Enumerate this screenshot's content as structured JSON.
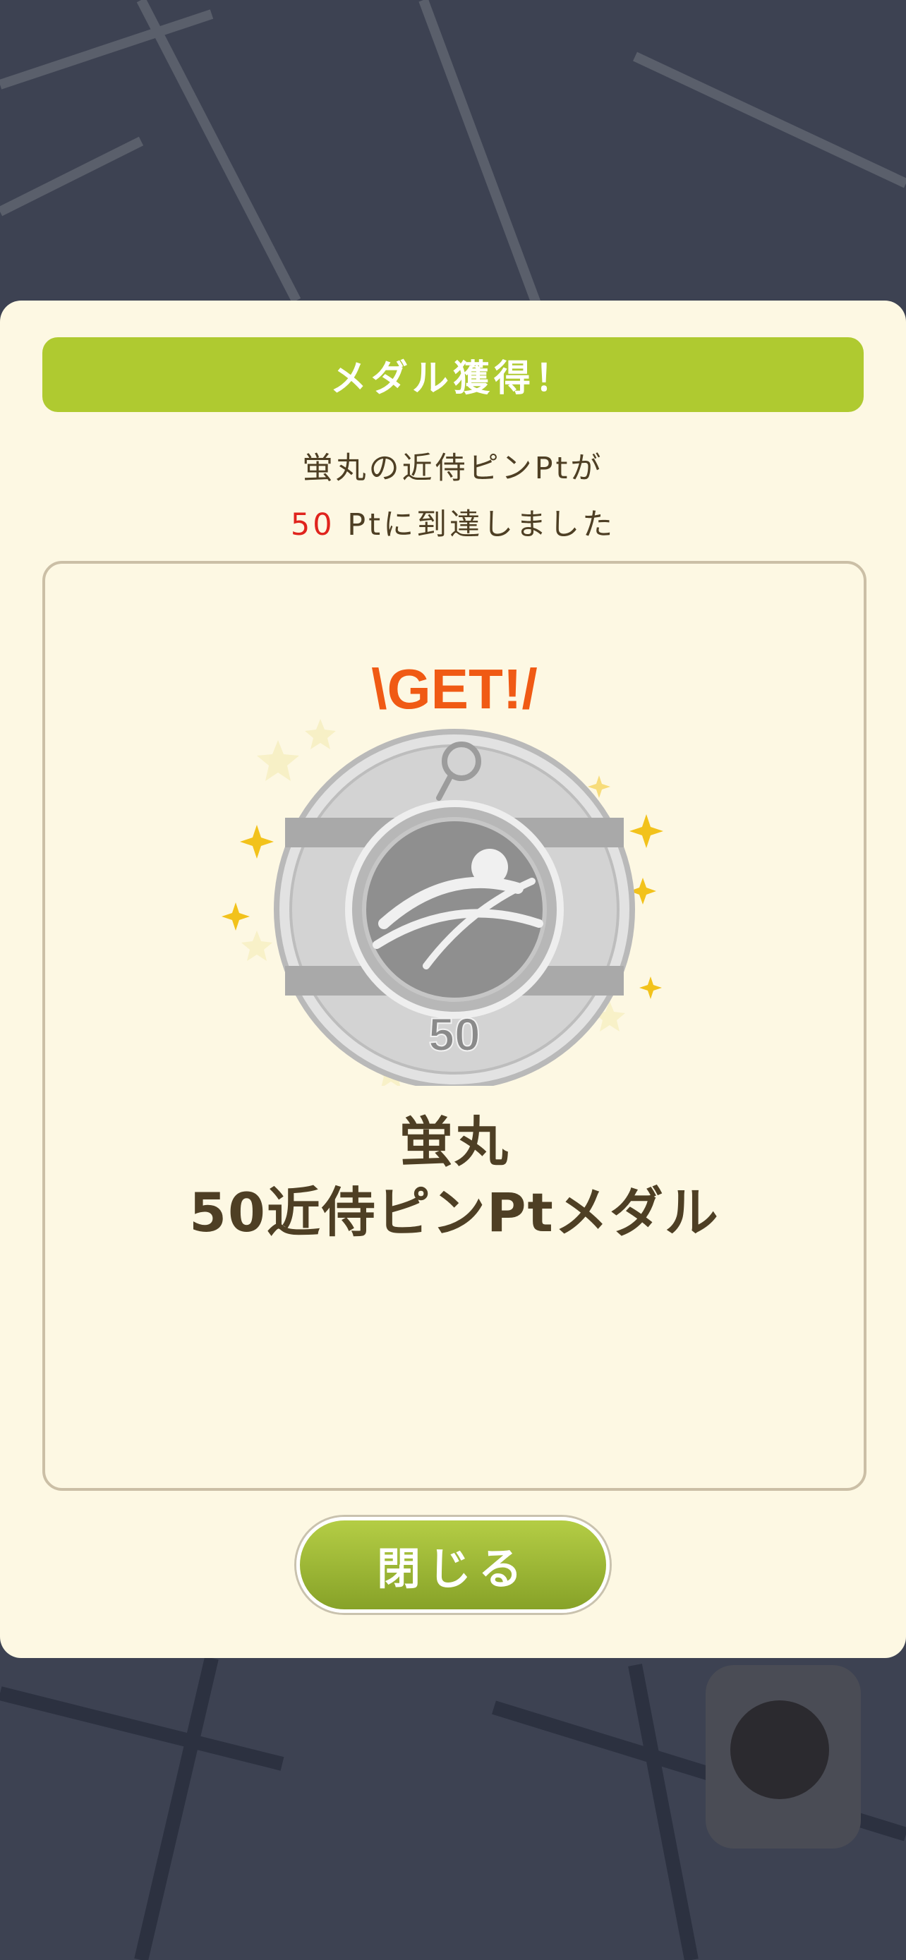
{
  "modal": {
    "title": "メダル獲得！",
    "message_line1": "蛍丸の近侍ピンPtが",
    "message_points": "50",
    "message_line2_rest": " Ptに到達しました",
    "badge_text": "\\GET!/",
    "medal_number": "50",
    "medal_name_line1": "蛍丸",
    "medal_name_line2": "50近侍ピンPtメダル",
    "close_label": "閉じる"
  },
  "colors": {
    "title_bar": "#afca30",
    "accent_red": "#e0241d",
    "text_brown": "#4e3f24",
    "panel_bg": "#fdf8e3",
    "get_orange": "#f05a14"
  },
  "icons": [
    "map-background",
    "medal-icon",
    "sparkle-icon",
    "get-badge-icon"
  ]
}
